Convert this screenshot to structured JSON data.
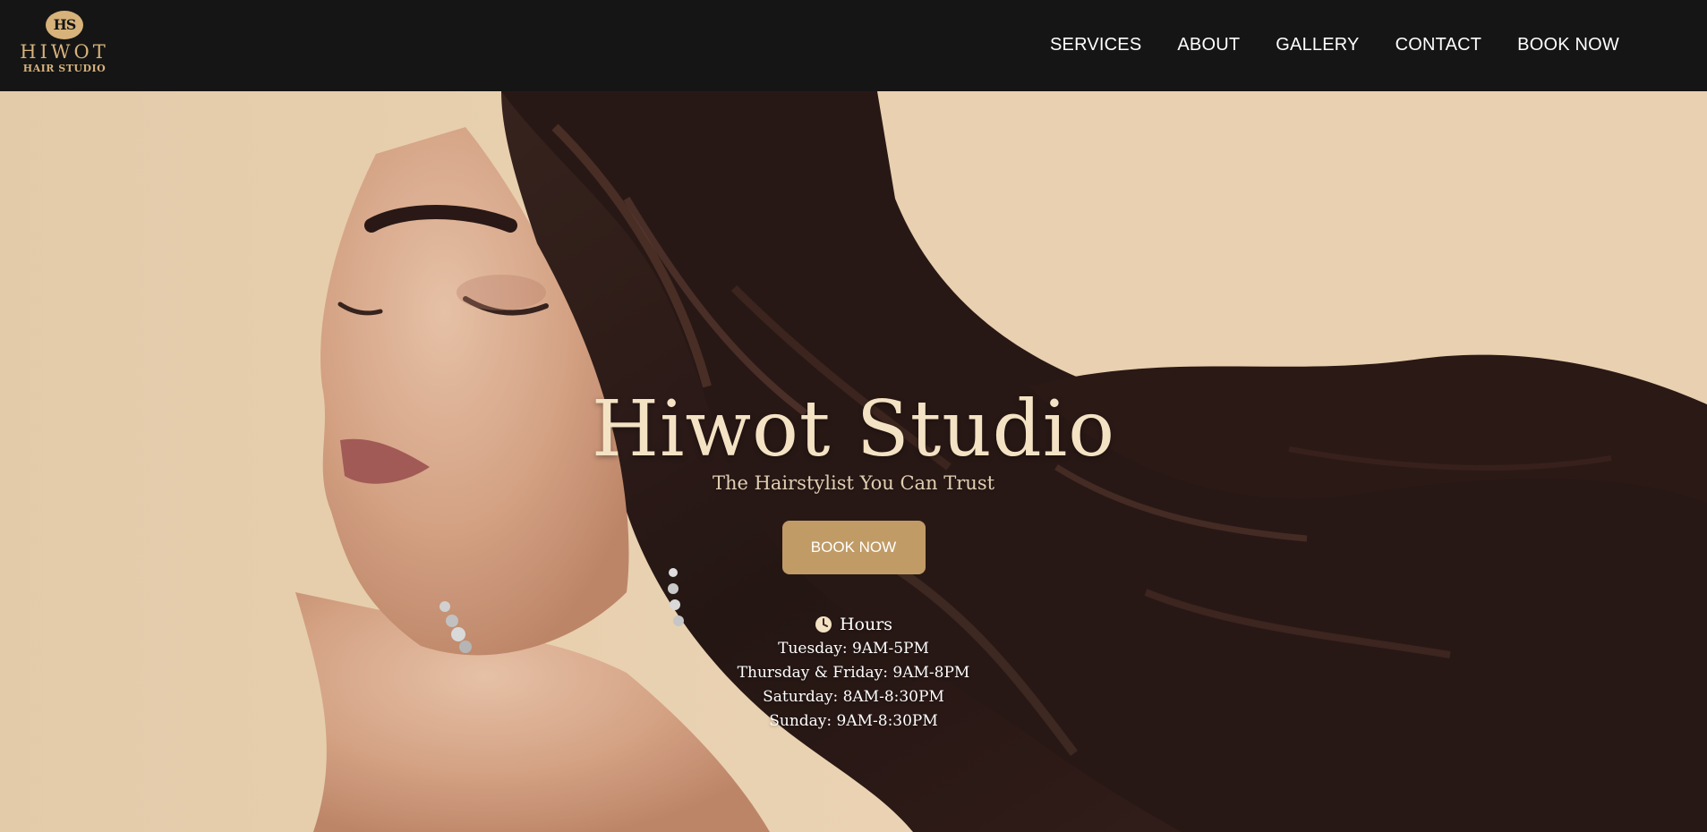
{
  "logo": {
    "monogram": "HS",
    "wordmark": "HIWOT",
    "subtitle": "HAIR STUDIO"
  },
  "nav": {
    "items": [
      "SERVICES",
      "ABOUT",
      "GALLERY",
      "CONTACT",
      "BOOK NOW"
    ]
  },
  "hero": {
    "title": "Hiwot Studio",
    "tagline": "The Hairstylist You Can Trust",
    "cta_label": "BOOK NOW",
    "hours": {
      "heading": "Hours",
      "lines": [
        "Tuesday: 9AM-5PM",
        "Thursday & Friday: 9AM-8PM",
        "Saturday: 8AM-8:30PM",
        "Sunday: 9AM-8:30PM"
      ]
    }
  },
  "colors": {
    "topbar": "#151515",
    "accent_gold": "#c19b66",
    "logo_gold": "#d7b27a",
    "hero_background": "#f1d8b5",
    "hair": "#2b1a16"
  },
  "icons": {
    "hours": "clock-icon"
  }
}
